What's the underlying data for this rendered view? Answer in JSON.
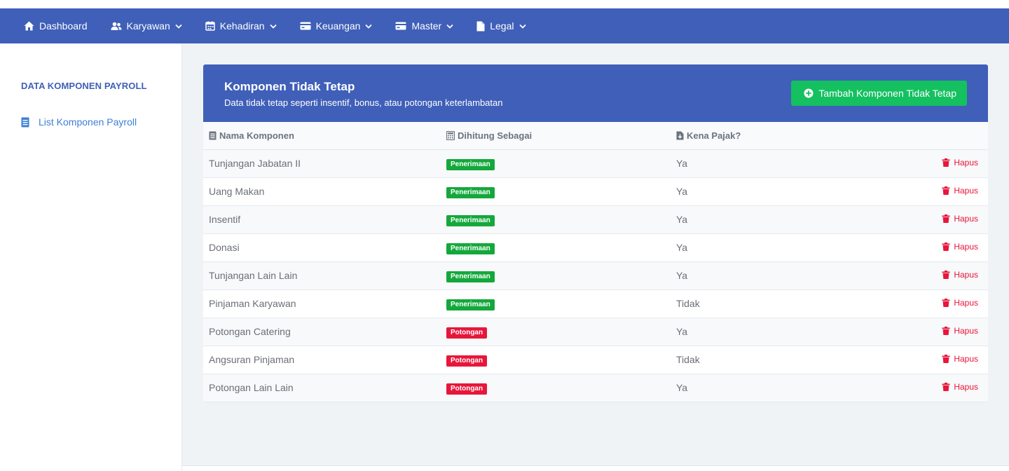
{
  "nav": {
    "items": [
      {
        "label": "Dashboard",
        "icon": "home-icon",
        "dropdown": false
      },
      {
        "label": "Karyawan",
        "icon": "users-icon",
        "dropdown": true
      },
      {
        "label": "Kehadiran",
        "icon": "calendar-icon",
        "dropdown": true
      },
      {
        "label": "Keuangan",
        "icon": "credit-card-icon",
        "dropdown": true
      },
      {
        "label": "Master",
        "icon": "credit-card-icon",
        "dropdown": true
      },
      {
        "label": "Legal",
        "icon": "file-icon",
        "dropdown": true
      }
    ]
  },
  "sidebar": {
    "heading": "DATA KOMPONEN PAYROLL",
    "link_label": "List Komponen Payroll"
  },
  "card": {
    "title": "Komponen Tidak Tetap",
    "subtitle": "Data tidak tetap seperti insentif, bonus, atau potongan keterlambatan",
    "add_button_label": "Tambah Komponen Tidak Tetap"
  },
  "table": {
    "headers": [
      "Nama Komponen",
      "Dihitung Sebagai",
      "Kena Pajak?"
    ],
    "rows": [
      {
        "name": "Tunjangan Jabatan II",
        "type": "Penerimaan",
        "taxed": "Ya",
        "action": "Hapus"
      },
      {
        "name": "Uang Makan",
        "type": "Penerimaan",
        "taxed": "Ya",
        "action": "Hapus"
      },
      {
        "name": "Insentif",
        "type": "Penerimaan",
        "taxed": "Ya",
        "action": "Hapus"
      },
      {
        "name": "Donasi",
        "type": "Penerimaan",
        "taxed": "Ya",
        "action": "Hapus"
      },
      {
        "name": "Tunjangan Lain Lain",
        "type": "Penerimaan",
        "taxed": "Ya",
        "action": "Hapus"
      },
      {
        "name": "Pinjaman Karyawan",
        "type": "Penerimaan",
        "taxed": "Tidak",
        "action": "Hapus"
      },
      {
        "name": "Potongan Catering",
        "type": "Potongan",
        "taxed": "Ya",
        "action": "Hapus"
      },
      {
        "name": "Angsuran Pinjaman",
        "type": "Potongan",
        "taxed": "Tidak",
        "action": "Hapus"
      },
      {
        "name": "Potongan Lain Lain",
        "type": "Potongan",
        "taxed": "Ya",
        "action": "Hapus"
      }
    ]
  },
  "colors": {
    "primary": "#3f5fb8",
    "success": "#14c060",
    "badge_green": "#14a83c",
    "danger": "#e8163b",
    "sidebar_link": "#3d7fd6"
  }
}
